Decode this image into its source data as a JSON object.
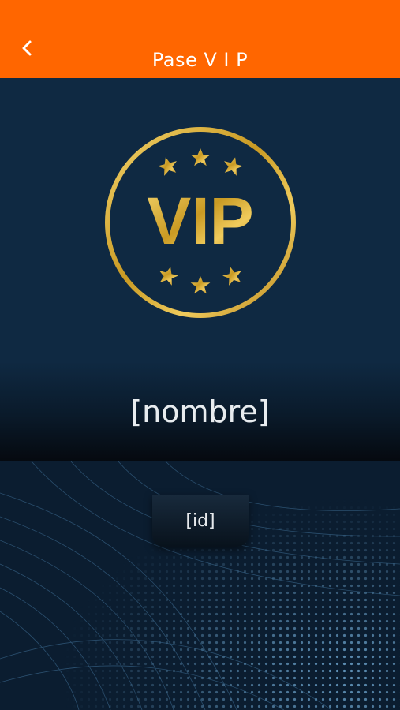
{
  "header": {
    "title": "Pase V I P",
    "back_icon": "chevron-left-icon",
    "color": "#ff6600"
  },
  "badge": {
    "text": "VIP",
    "icon": "vip-emblem",
    "gold": "#d4a62c"
  },
  "pass": {
    "name": "[nombre]",
    "id": "[id]"
  }
}
